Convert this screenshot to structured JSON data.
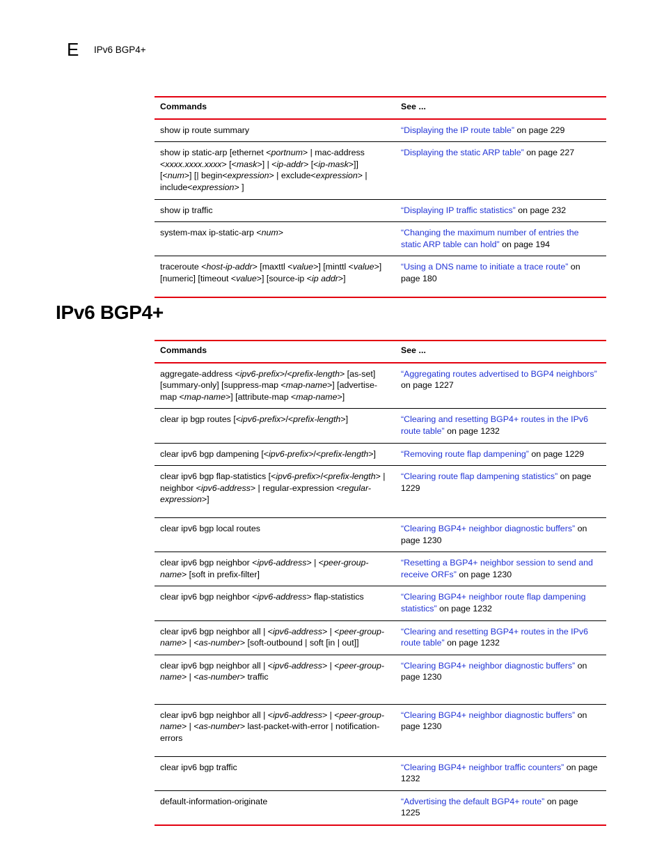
{
  "header": {
    "appendix_letter": "E",
    "title": "IPv6 BGP4+"
  },
  "section": {
    "heading": "IPv6 BGP4+"
  },
  "tables": [
    {
      "id": "table-ip-misc",
      "columns": {
        "commands": "Commands",
        "see": "See ..."
      },
      "rows": [
        {
          "command": "show ip route summary",
          "see_link": "“Displaying the IP route table”",
          "see_tail": " on page 229"
        },
        {
          "command": "show ip static-arp [ethernet <portnum> | mac-address <xxxx.xxxx.xxxx> [<mask>] | <ip-addr> [<ip-mask>]] [<num>] [| begin<expression> | exclude<expression> | include<expression> ]",
          "see_link": "“Displaying the static ARP table”",
          "see_tail": " on page 227"
        },
        {
          "command": "show ip traffic",
          "see_link": "“Displaying IP traffic statistics”",
          "see_tail": " on page 232"
        },
        {
          "command": "system-max ip-static-arp <num>",
          "see_link": "“Changing the maximum number of entries the static ARP table can hold”",
          "see_tail": " on page 194"
        },
        {
          "command": "traceroute <host-ip-addr> [maxttl <value>] [minttl <value>] [numeric] [timeout <value>] [source-ip <ip addr>]",
          "see_link": "“Using a DNS name to initiate a trace route”",
          "see_tail": " on page 180"
        }
      ]
    },
    {
      "id": "table-bgp4",
      "columns": {
        "commands": "Commands",
        "see": "See ..."
      },
      "rows": [
        {
          "command": "aggregate-address <ipv6-prefix>/<prefix-length> [as-set] [summary-only] [suppress-map <map-name>] [advertise-map <map-name>] [attribute-map <map-name>]",
          "see_link": "“Aggregating routes advertised to BGP4 neighbors”",
          "see_tail": " on page 1227"
        },
        {
          "command": "clear ip bgp routes [<ipv6-prefix>/<prefix-length>]",
          "see_link": "“Clearing and resetting BGP4+ routes in the IPv6 route table”",
          "see_tail": " on page 1232"
        },
        {
          "command": "clear ipv6 bgp dampening [<ipv6-prefix>/<prefix-length>]",
          "see_link": "“Removing route flap dampening”",
          "see_tail": " on page 1229"
        },
        {
          "command": "clear ipv6 bgp flap-statistics [<ipv6-prefix>/<prefix-length> | neighbor <ipv6-address> | regular-expression <regular-expression>]",
          "see_link": "“Clearing route flap dampening statistics”",
          "see_tail": " on page 1229"
        },
        {
          "command": "clear ipv6 bgp local routes",
          "see_link": "“Clearing BGP4+ neighbor diagnostic buffers”",
          "see_tail": " on page 1230"
        },
        {
          "command": "clear ipv6 bgp neighbor <ipv6-address> | <peer-group-name> [soft in prefix-filter]",
          "see_link": "“Resetting a BGP4+ neighbor session to send and receive ORFs”",
          "see_tail": " on page 1230"
        },
        {
          "command": "clear ipv6 bgp neighbor <ipv6-address> flap-statistics",
          "see_link": "“Clearing BGP4+ neighbor route flap dampening statistics”",
          "see_tail": " on page 1232"
        },
        {
          "command": "clear ipv6 bgp neighbor all | <ipv6-address> | <peer-group-name> | <as-number> [soft-outbound | soft [in | out]]",
          "see_link": "“Clearing and resetting BGP4+ routes in the IPv6 route table”",
          "see_tail": " on page 1232"
        },
        {
          "command": "clear ipv6 bgp neighbor all | <ipv6-address> | <peer-group-name> | <as-number> traffic",
          "see_link": "“Clearing BGP4+ neighbor diagnostic buffers”",
          "see_tail": " on page 1230"
        },
        {
          "command": "clear ipv6 bgp neighbor all | <ipv6-address> | <peer-group-name> | <as-number> last-packet-with-error | notification-errors",
          "see_link": "“Clearing BGP4+ neighbor diagnostic buffers”",
          "see_tail": " on page 1230"
        },
        {
          "command": "clear ipv6 bgp traffic",
          "see_link": "“Clearing BGP4+ neighbor traffic counters”",
          "see_tail": " on page 1232"
        },
        {
          "command": "default-information-originate",
          "see_link": "“Advertising the default BGP4+ route”",
          "see_tail": " on page 1225"
        }
      ]
    }
  ],
  "colors": {
    "rule_red": "#e3000f",
    "link_blue": "#2234d6",
    "text": "#000000"
  }
}
